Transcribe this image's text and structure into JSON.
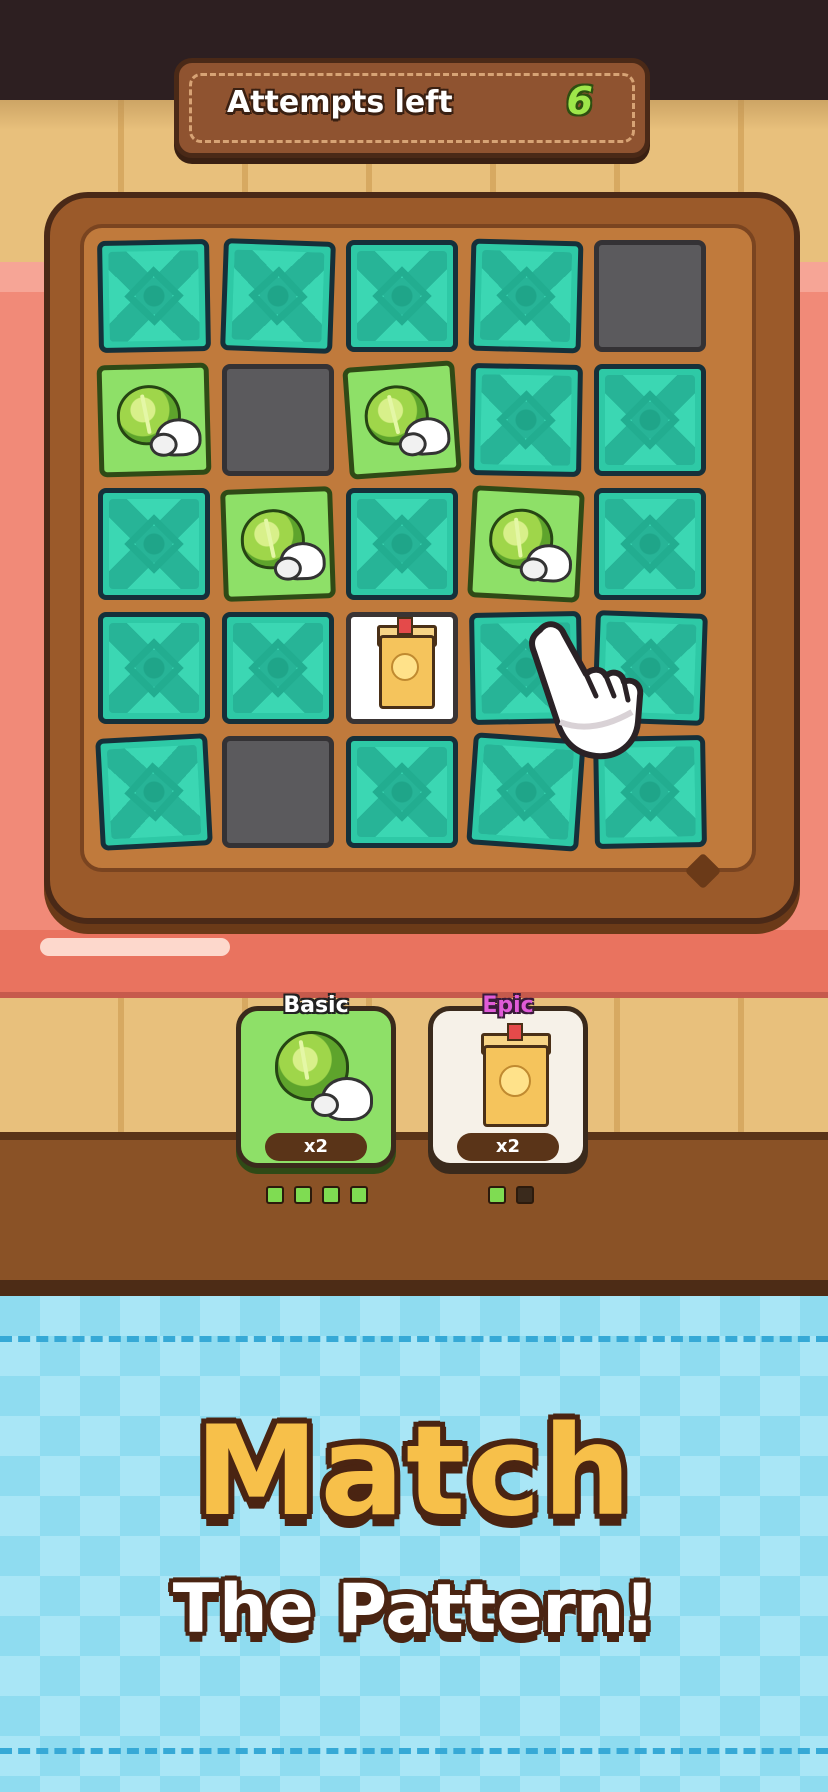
{
  "banner": {
    "label": "Attempts left",
    "value": "6"
  },
  "board": {
    "rows": [
      [
        "card-back",
        "card-back",
        "card-back",
        "card-back",
        "empty"
      ],
      [
        "cabbage-mushroom",
        "empty",
        "cabbage-mushroom",
        "card-back",
        "card-back"
      ],
      [
        "card-back",
        "cabbage-mushroom",
        "card-back",
        "cabbage-mushroom",
        "card-back"
      ],
      [
        "card-back",
        "card-back",
        "milk-carton",
        "card-back",
        "card-back"
      ],
      [
        "card-back",
        "empty",
        "card-back",
        "card-back",
        "card-back"
      ]
    ]
  },
  "goals": [
    {
      "tier": "Basic",
      "count": "x2",
      "item": "cabbage-mushroom",
      "progress": {
        "filled": 4,
        "total": 4
      }
    },
    {
      "tier": "Epic",
      "count": "x2",
      "item": "milk-carton",
      "progress": {
        "filled": 1,
        "total": 2
      }
    }
  ],
  "headline": {
    "title": "Match",
    "subtitle": "The Pattern!"
  },
  "colors": {
    "card_back": "#2ec9a6",
    "revealed_basic": "#8ee068",
    "revealed_epic": "#ffffff",
    "empty": "#5b5a5d",
    "title": "#f7c04a",
    "accent_counter": "#9ee64a"
  },
  "icons": [
    "cabbage-mushroom-icon",
    "milk-carton-icon",
    "pointing-hand-icon"
  ]
}
